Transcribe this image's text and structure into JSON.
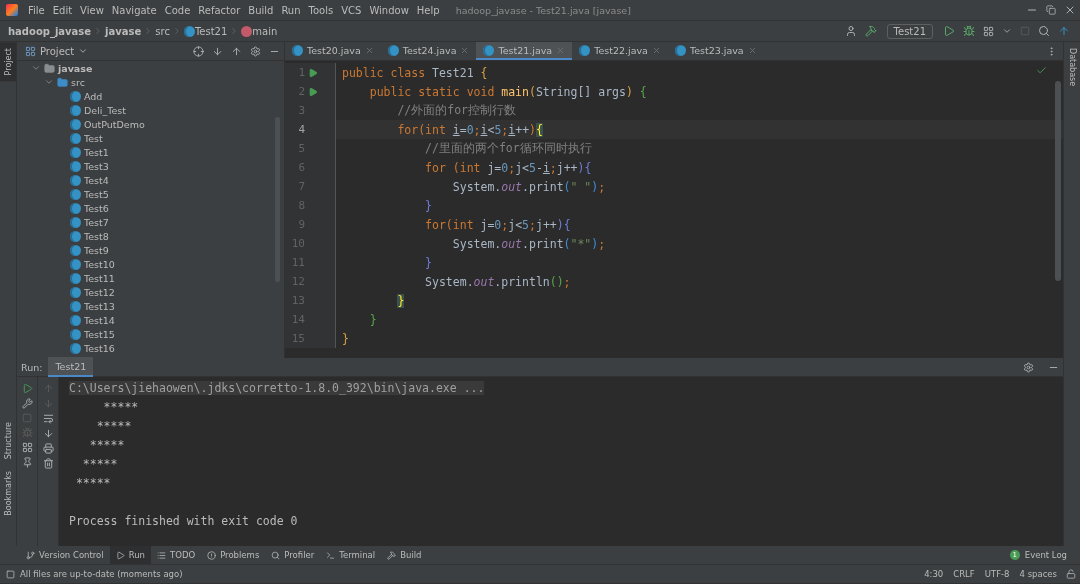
{
  "window": {
    "title": "hadoop_javase - Test21.java [javase]"
  },
  "menu": [
    "File",
    "Edit",
    "View",
    "Navigate",
    "Code",
    "Refactor",
    "Build",
    "Run",
    "Tools",
    "VCS",
    "Window",
    "Help"
  ],
  "breadcrumbs": [
    {
      "label": "hadoop_javase",
      "kind": "project"
    },
    {
      "label": "javase",
      "kind": "module"
    },
    {
      "label": "src",
      "kind": "folder"
    },
    {
      "label": "Test21",
      "kind": "class"
    },
    {
      "label": "main",
      "kind": "method"
    }
  ],
  "toolbar": {
    "run_config": "Test21"
  },
  "left_strip": [
    {
      "label": "Project",
      "selected": true
    },
    {
      "label": "Structure",
      "selected": false
    },
    {
      "label": "Bookmarks",
      "selected": false
    }
  ],
  "right_strip": [
    {
      "label": "Database",
      "selected": false
    }
  ],
  "project_panel": {
    "title": "Project",
    "tree": [
      {
        "label": "javase",
        "kind": "module",
        "expanded": true,
        "children": [
          {
            "label": "src",
            "kind": "folder",
            "expanded": true,
            "children": [
              {
                "label": "Add",
                "kind": "class"
              },
              {
                "label": "Deli_Test",
                "kind": "class"
              },
              {
                "label": "OutPutDemo",
                "kind": "class"
              },
              {
                "label": "Test",
                "kind": "class"
              },
              {
                "label": "Test1",
                "kind": "class"
              },
              {
                "label": "Test3",
                "kind": "class"
              },
              {
                "label": "Test4",
                "kind": "class"
              },
              {
                "label": "Test5",
                "kind": "class"
              },
              {
                "label": "Test6",
                "kind": "class"
              },
              {
                "label": "Test7",
                "kind": "class"
              },
              {
                "label": "Test8",
                "kind": "class"
              },
              {
                "label": "Test9",
                "kind": "class"
              },
              {
                "label": "Test10",
                "kind": "class"
              },
              {
                "label": "Test11",
                "kind": "class"
              },
              {
                "label": "Test12",
                "kind": "class"
              },
              {
                "label": "Test13",
                "kind": "class"
              },
              {
                "label": "Test14",
                "kind": "class"
              },
              {
                "label": "Test15",
                "kind": "class"
              },
              {
                "label": "Test16",
                "kind": "class"
              }
            ]
          }
        ]
      }
    ]
  },
  "editor_tabs": [
    {
      "label": "Test20.java",
      "selected": false
    },
    {
      "label": "Test24.java",
      "selected": false
    },
    {
      "label": "Test21.java",
      "selected": true
    },
    {
      "label": "Test22.java",
      "selected": false
    },
    {
      "label": "Test23.java",
      "selected": false
    }
  ],
  "editor": {
    "lines": [
      {
        "number": "1",
        "run": true,
        "current": false,
        "tokens": [
          {
            "kind": "keyword",
            "text": "public class "
          },
          {
            "kind": "plain",
            "text": "Test21 "
          },
          {
            "kind": "brace1",
            "text": "{"
          }
        ]
      },
      {
        "number": "2",
        "run": true,
        "current": false,
        "tokens": [
          {
            "kind": "keyword",
            "text": "    public static void "
          },
          {
            "kind": "method",
            "text": "main"
          },
          {
            "kind": "brace1",
            "text": "("
          },
          {
            "kind": "plain",
            "text": "String[] args"
          },
          {
            "kind": "brace1",
            "text": ")"
          },
          {
            "kind": "brace2",
            "text": " {"
          }
        ]
      },
      {
        "number": "3",
        "run": false,
        "current": false,
        "tokens": [
          {
            "kind": "comment",
            "text": "        //外面的for控制行数"
          }
        ]
      },
      {
        "number": "4",
        "run": false,
        "current": true,
        "tokens": [
          {
            "kind": "keyword",
            "text": "        for(int "
          },
          {
            "kind": "variable",
            "text": "i"
          },
          {
            "kind": "plain",
            "text": "="
          },
          {
            "kind": "number",
            "text": "0"
          },
          {
            "kind": "keyword",
            "text": ";"
          },
          {
            "kind": "variable",
            "text": "i"
          },
          {
            "kind": "plain",
            "text": "<"
          },
          {
            "kind": "number",
            "text": "5"
          },
          {
            "kind": "keyword",
            "text": ";"
          },
          {
            "kind": "variable",
            "text": "i"
          },
          {
            "kind": "plain",
            "text": "++"
          },
          {
            "kind": "keyword",
            "text": ")"
          },
          {
            "kind": "match",
            "text": "{"
          }
        ]
      },
      {
        "number": "5",
        "run": false,
        "current": false,
        "tokens": [
          {
            "kind": "comment",
            "text": "            //里面的两个for循环同时执行"
          }
        ]
      },
      {
        "number": "6",
        "run": false,
        "current": false,
        "tokens": [
          {
            "kind": "keyword",
            "text": "            for (int "
          },
          {
            "kind": "plain",
            "text": "j="
          },
          {
            "kind": "number",
            "text": "0"
          },
          {
            "kind": "keyword",
            "text": ";"
          },
          {
            "kind": "plain",
            "text": "j<"
          },
          {
            "kind": "number",
            "text": "5"
          },
          {
            "kind": "plain",
            "text": "-"
          },
          {
            "kind": "variable",
            "text": "i"
          },
          {
            "kind": "keyword",
            "text": ";"
          },
          {
            "kind": "plain",
            "text": "j++"
          },
          {
            "kind": "brace3",
            "text": "){"
          }
        ]
      },
      {
        "number": "7",
        "run": false,
        "current": false,
        "tokens": [
          {
            "kind": "plain",
            "text": "                System."
          },
          {
            "kind": "field",
            "text": "out"
          },
          {
            "kind": "plain",
            "text": ".print"
          },
          {
            "kind": "brace4",
            "text": "("
          },
          {
            "kind": "string",
            "text": "\" \""
          },
          {
            "kind": "brace4",
            "text": ")"
          },
          {
            "kind": "keyword",
            "text": ";"
          }
        ]
      },
      {
        "number": "8",
        "run": false,
        "current": false,
        "tokens": [
          {
            "kind": "brace3",
            "text": "            }"
          }
        ]
      },
      {
        "number": "9",
        "run": false,
        "current": false,
        "tokens": [
          {
            "kind": "keyword",
            "text": "            for(int "
          },
          {
            "kind": "plain",
            "text": "j="
          },
          {
            "kind": "number",
            "text": "0"
          },
          {
            "kind": "keyword",
            "text": ";"
          },
          {
            "kind": "plain",
            "text": "j<"
          },
          {
            "kind": "number",
            "text": "5"
          },
          {
            "kind": "keyword",
            "text": ";"
          },
          {
            "kind": "plain",
            "text": "j++"
          },
          {
            "kind": "brace3",
            "text": "){"
          }
        ]
      },
      {
        "number": "10",
        "run": false,
        "current": false,
        "tokens": [
          {
            "kind": "plain",
            "text": "                System."
          },
          {
            "kind": "field",
            "text": "out"
          },
          {
            "kind": "plain",
            "text": ".print"
          },
          {
            "kind": "brace4",
            "text": "("
          },
          {
            "kind": "string",
            "text": "\"*\""
          },
          {
            "kind": "brace4",
            "text": ")"
          },
          {
            "kind": "keyword",
            "text": ";"
          }
        ]
      },
      {
        "number": "11",
        "run": false,
        "current": false,
        "tokens": [
          {
            "kind": "brace3",
            "text": "            }"
          }
        ]
      },
      {
        "number": "12",
        "run": false,
        "current": false,
        "tokens": [
          {
            "kind": "plain",
            "text": "            System."
          },
          {
            "kind": "field",
            "text": "out"
          },
          {
            "kind": "plain",
            "text": ".println"
          },
          {
            "kind": "brace2",
            "text": "()"
          },
          {
            "kind": "keyword",
            "text": ";"
          }
        ]
      },
      {
        "number": "13",
        "run": false,
        "current": false,
        "tokens": [
          {
            "kind": "match",
            "text": "        }"
          }
        ]
      },
      {
        "number": "14",
        "run": false,
        "current": false,
        "tokens": [
          {
            "kind": "brace2",
            "text": "    }"
          }
        ]
      },
      {
        "number": "15",
        "run": false,
        "current": false,
        "tokens": [
          {
            "kind": "brace1",
            "text": "}"
          }
        ]
      }
    ]
  },
  "run_panel": {
    "label": "Run:",
    "tab": "Test21",
    "output": [
      {
        "kind": "command",
        "text": "C:\\Users\\jiehaowen\\.jdks\\corretto-1.8.0_392\\bin\\java.exe ..."
      },
      {
        "kind": "stdout",
        "text": "     *****"
      },
      {
        "kind": "stdout",
        "text": "    *****"
      },
      {
        "kind": "stdout",
        "text": "   *****"
      },
      {
        "kind": "stdout",
        "text": "  *****"
      },
      {
        "kind": "stdout",
        "text": " *****"
      },
      {
        "kind": "exit",
        "text": "Process finished with exit code 0"
      }
    ]
  },
  "tool_tabs": [
    {
      "label": "Version Control",
      "kind": "vcs",
      "selected": false
    },
    {
      "label": "Run",
      "kind": "run",
      "selected": true
    },
    {
      "label": "TODO",
      "kind": "todo",
      "selected": false
    },
    {
      "label": "Problems",
      "kind": "problems",
      "selected": false
    },
    {
      "label": "Profiler",
      "kind": "profiler",
      "selected": false
    },
    {
      "label": "Terminal",
      "kind": "terminal",
      "selected": false
    },
    {
      "label": "Build",
      "kind": "build",
      "selected": false
    }
  ],
  "event_log": {
    "label": "Event Log",
    "count": "1"
  },
  "status_bar": {
    "message": "All files are up-to-date (moments ago)",
    "items": [
      "4:30",
      "CRLF",
      "UTF-8",
      "4 spaces"
    ]
  }
}
